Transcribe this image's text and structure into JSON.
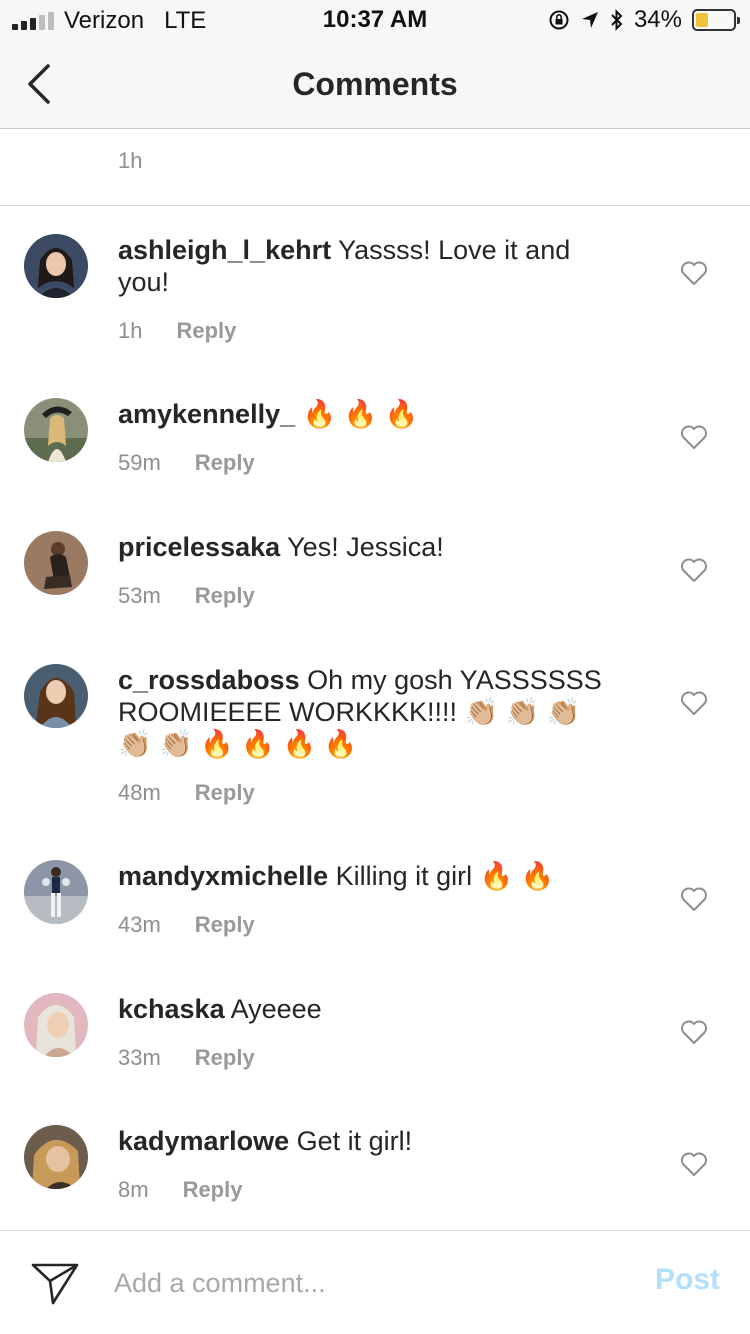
{
  "status_bar": {
    "carrier": "Verizon",
    "network": "LTE",
    "time": "10:37 AM",
    "battery_percent": "34%",
    "battery_level": 0.34,
    "icons": [
      "orientation-lock-icon",
      "location-arrow-icon",
      "bluetooth-icon"
    ]
  },
  "nav": {
    "title": "Comments",
    "back_icon": "chevron-left-icon"
  },
  "caption": {
    "time": "1h"
  },
  "comments": [
    {
      "username": "ashleigh_l_kehrt",
      "text": "Yassss! Love it and you!",
      "time": "1h",
      "reply_label": "Reply",
      "avatar_color": "#3d4a63"
    },
    {
      "username": "amykennelly_",
      "text": "🔥 🔥 🔥",
      "time": "59m",
      "reply_label": "Reply",
      "avatar_color": "#8a8f7a"
    },
    {
      "username": "pricelessaka",
      "text": "Yes! Jessica!",
      "time": "53m",
      "reply_label": "Reply",
      "avatar_color": "#9a7a63"
    },
    {
      "username": "c_rossdaboss",
      "text": "Oh my gosh YASSSSSS ROOMIEEEE WORKKKK!!!! 👏🏼 👏🏼 👏🏼 👏🏼 👏🏼 🔥 🔥 🔥 🔥",
      "time": "48m",
      "reply_label": "Reply",
      "avatar_color": "#4a5e72"
    },
    {
      "username": "mandyxmichelle",
      "text": "Killing it girl 🔥 🔥",
      "time": "43m",
      "reply_label": "Reply",
      "avatar_color": "#8c96a6"
    },
    {
      "username": "kchaska",
      "text": "Ayeeee",
      "time": "33m",
      "reply_label": "Reply",
      "avatar_color": "#e3b7c0"
    },
    {
      "username": "kadymarlowe",
      "text": "Get it girl!",
      "time": "8m",
      "reply_label": "Reply",
      "avatar_color": "#6b5c4c"
    }
  ],
  "comment_box": {
    "placeholder": "Add a comment...",
    "value": "",
    "post_label": "Post",
    "send_icon": "paper-plane-icon"
  },
  "colors": {
    "text": "#262626",
    "secondary": "#8e8e8e",
    "post_disabled": "#b2dffc",
    "battery": "#f0c33a"
  }
}
